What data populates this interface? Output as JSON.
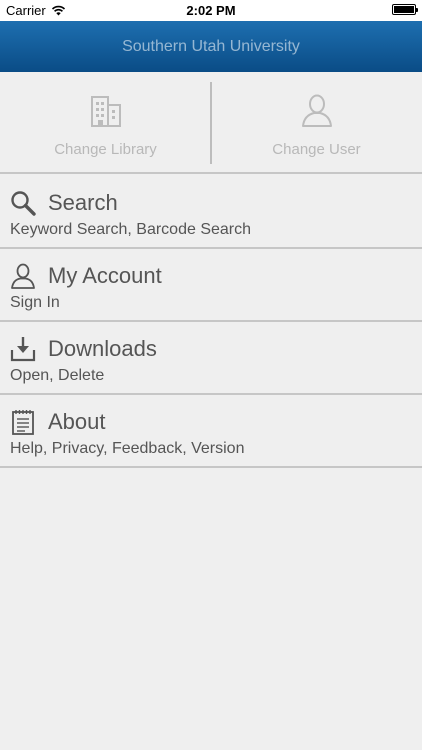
{
  "status": {
    "carrier": "Carrier",
    "time": "2:02 PM"
  },
  "header": {
    "title": "Southern Utah University"
  },
  "actions": {
    "change_library": "Change Library",
    "change_user": "Change User"
  },
  "menu": [
    {
      "title": "Search",
      "subtitle": "Keyword Search, Barcode Search",
      "icon": "search-icon"
    },
    {
      "title": "My Account",
      "subtitle": "Sign In",
      "icon": "user-icon"
    },
    {
      "title": "Downloads",
      "subtitle": "Open, Delete",
      "icon": "download-icon"
    },
    {
      "title": "About",
      "subtitle": "Help, Privacy, Feedback, Version",
      "icon": "notepad-icon"
    }
  ],
  "colors": {
    "header_top": "#1e6fb0",
    "header_bottom": "#0a4c86",
    "background": "#efefef",
    "divider": "#c6c6c6"
  }
}
